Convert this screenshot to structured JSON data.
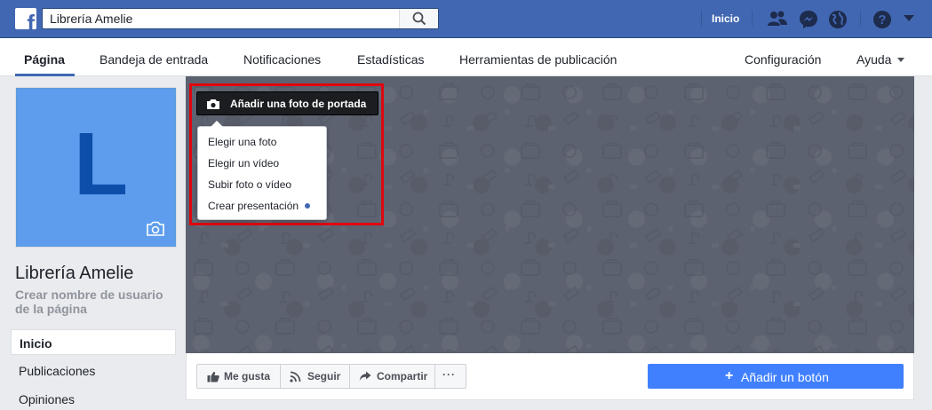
{
  "topbar": {
    "logo": "f",
    "search_value": "Librería Amelie",
    "home": "Inicio",
    "icons": [
      "friends-icon",
      "messenger-icon",
      "globe-icon",
      "help-icon",
      "caret-down-icon"
    ]
  },
  "tabs": {
    "page": "Página",
    "inbox": "Bandeja de entrada",
    "notifications": "Notificaciones",
    "stats": "Estadísticas",
    "publishing": "Herramientas de publicación",
    "settings": "Configuración",
    "help": "Ayuda"
  },
  "profile": {
    "letter": "L",
    "name": "Librería Amelie",
    "username_prompt": "Crear nombre de usuario de la página"
  },
  "left_nav": [
    "Inicio",
    "Publicaciones",
    "Opiniones"
  ],
  "cover": {
    "add_photo_button": "Añadir una foto de portada",
    "menu": [
      "Elegir una foto",
      "Elegir un vídeo",
      "Subir foto o vídeo",
      "Crear presentación"
    ]
  },
  "actions": {
    "like": "Me gusta",
    "follow": "Seguir",
    "share": "Compartir",
    "more": "···",
    "add_button": "Añadir un botón"
  },
  "colors": {
    "brand": "#4267b2",
    "cover": "#5d6270",
    "highlight": "#e0060f",
    "primary_button": "#4080ff"
  }
}
